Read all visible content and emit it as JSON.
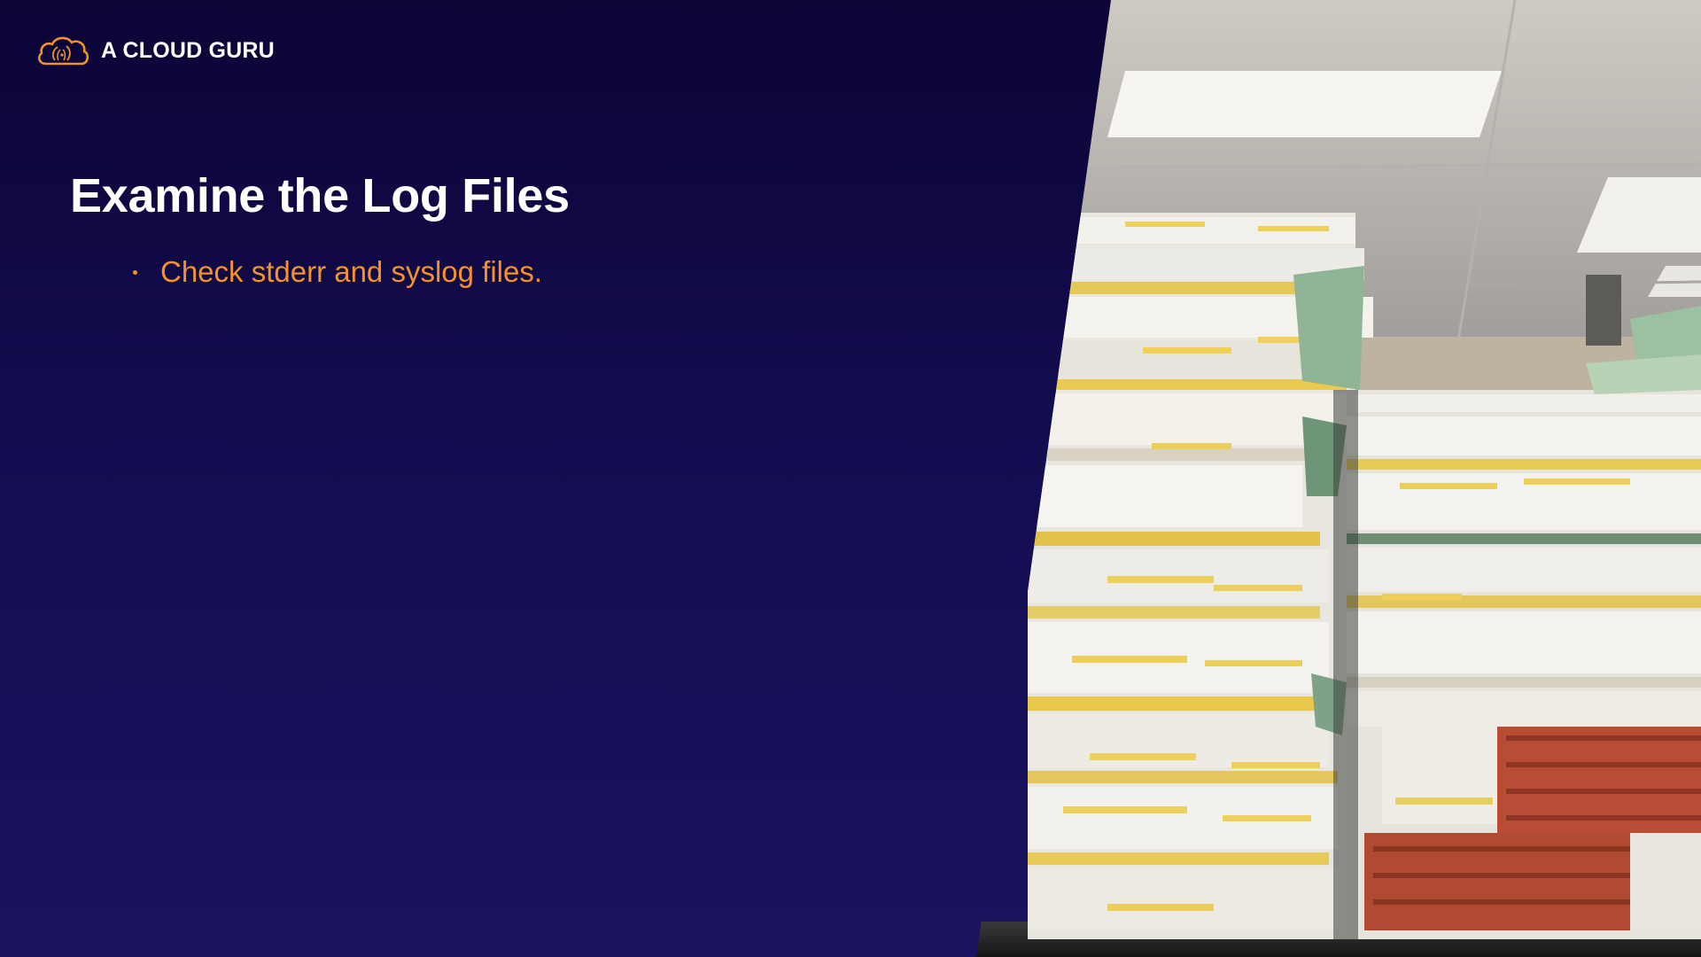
{
  "brand": {
    "name": "A CLOUD GURU",
    "logo_icon": "cloud-logo-icon",
    "accent_color": "#f3922b"
  },
  "slide": {
    "title": "Examine the Log Files",
    "bullets": [
      "Check stderr and syslog files."
    ],
    "photo_subject": "stacks-of-paper-files-icon"
  },
  "colors": {
    "background_top": "#0c0536",
    "background_bottom": "#1a1460",
    "title": "#ffffff",
    "bullet_text": "#f3922b"
  }
}
